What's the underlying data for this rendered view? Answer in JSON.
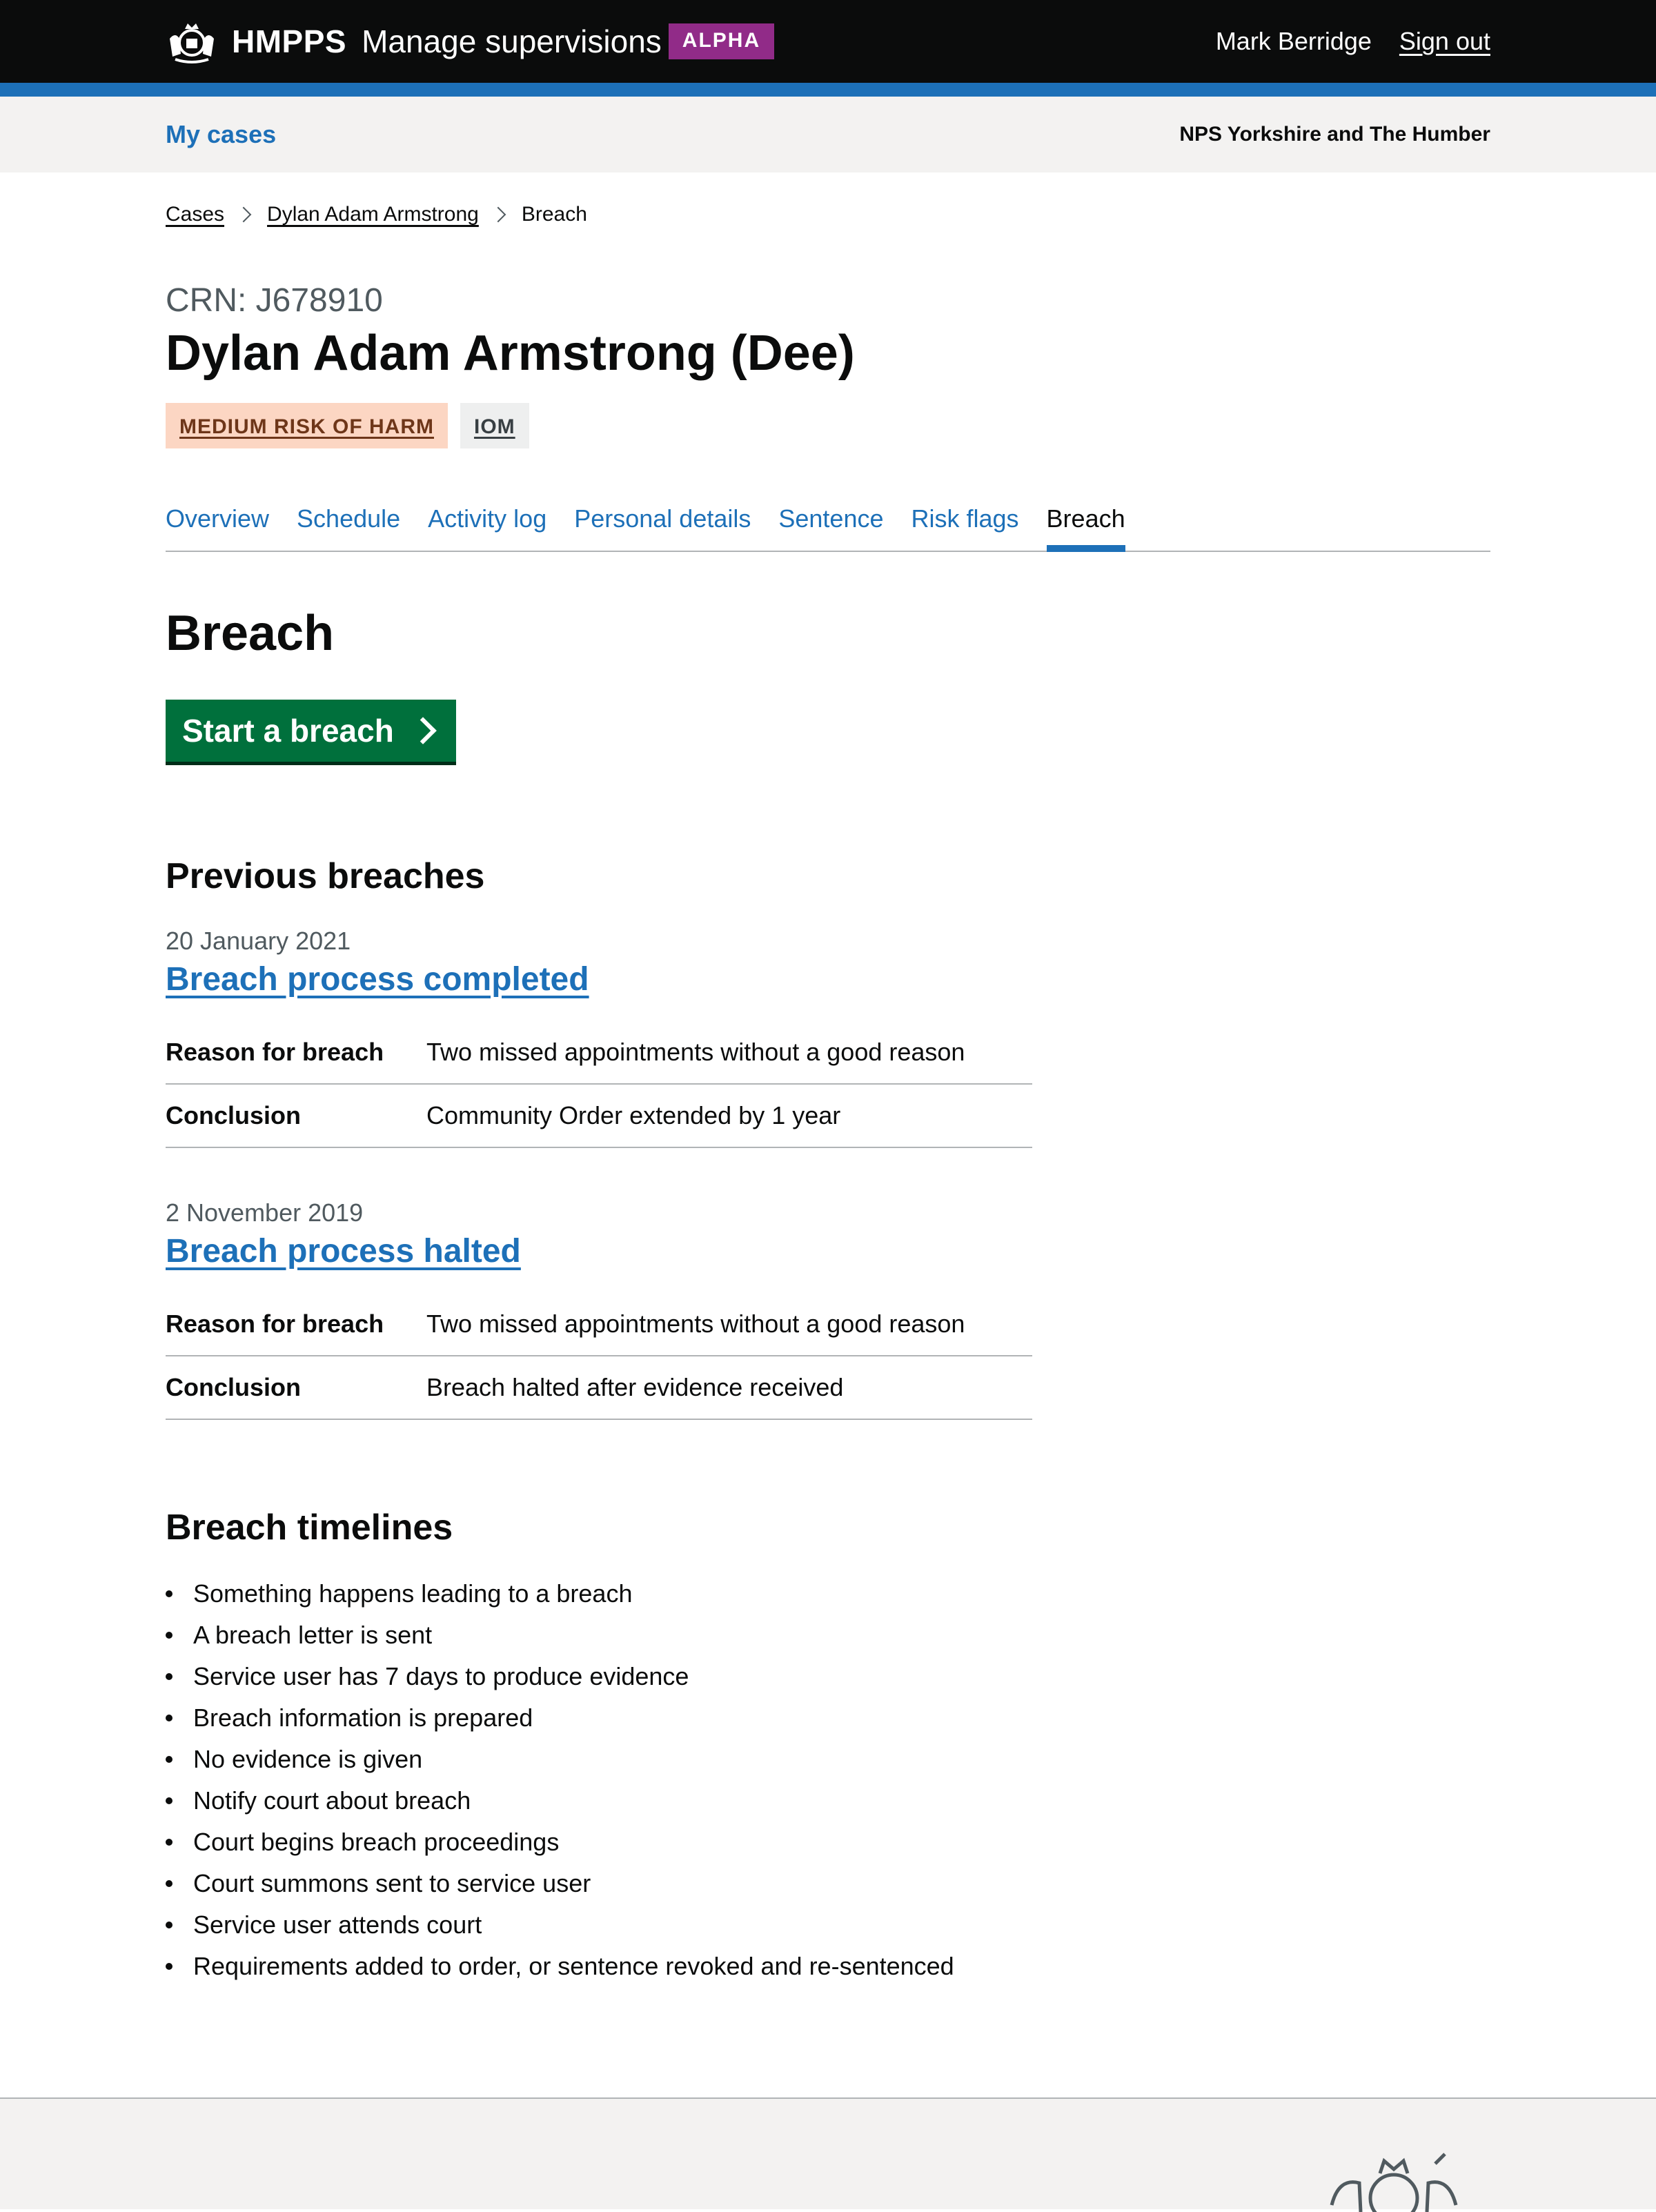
{
  "header": {
    "org": "HMPPS",
    "service": "Manage supervisions",
    "phase": "ALPHA",
    "user": "Mark Berridge",
    "signout": "Sign out"
  },
  "service_nav": {
    "my_cases": "My cases",
    "region": "NPS Yorkshire and The Humber"
  },
  "breadcrumbs": [
    "Cases",
    "Dylan Adam Armstrong",
    "Breach"
  ],
  "person": {
    "crn": "CRN: J678910",
    "name": "Dylan Adam Armstrong (Dee)",
    "tags": [
      "MEDIUM RISK OF HARM",
      "IOM"
    ]
  },
  "tabs": [
    "Overview",
    "Schedule",
    "Activity log",
    "Personal details",
    "Sentence",
    "Risk flags",
    "Breach"
  ],
  "active_tab": "Breach",
  "page_title": "Breach",
  "start_button": "Start a breach",
  "previous": {
    "heading": "Previous breaches",
    "items": [
      {
        "date": "20 January 2021",
        "title": "Breach process completed",
        "rows": [
          {
            "key": "Reason for breach",
            "value": "Two missed appointments without a good reason"
          },
          {
            "key": "Conclusion",
            "value": "Community Order extended by 1 year"
          }
        ]
      },
      {
        "date": "2 November 2019",
        "title": "Breach process halted",
        "rows": [
          {
            "key": "Reason for breach",
            "value": "Two missed appointments without a good reason"
          },
          {
            "key": "Conclusion",
            "value": "Breach halted after evidence received"
          }
        ]
      }
    ]
  },
  "timelines": {
    "heading": "Breach timelines",
    "items": [
      "Something happens leading to a breach",
      "A breach letter is sent",
      "Service user has 7 days to produce evidence",
      "Breach information is prepared",
      "No evidence is given",
      "Notify court about breach",
      "Court begins breach proceedings",
      "Court summons sent to service user",
      "Service user attends court",
      "Requirements added to order, or sentence revoked and re-sentenced"
    ]
  },
  "colors": {
    "header_bg": "#0b0c0c",
    "brand_blue": "#1d70b8",
    "alpha_tag": "#912b88",
    "start_button": "#00703c",
    "risk_tag_bg": "#fcd6c3"
  },
  "icons": [
    "royal-crest-icon",
    "chevron-right-icon",
    "breadcrumb-chevron-icon"
  ]
}
